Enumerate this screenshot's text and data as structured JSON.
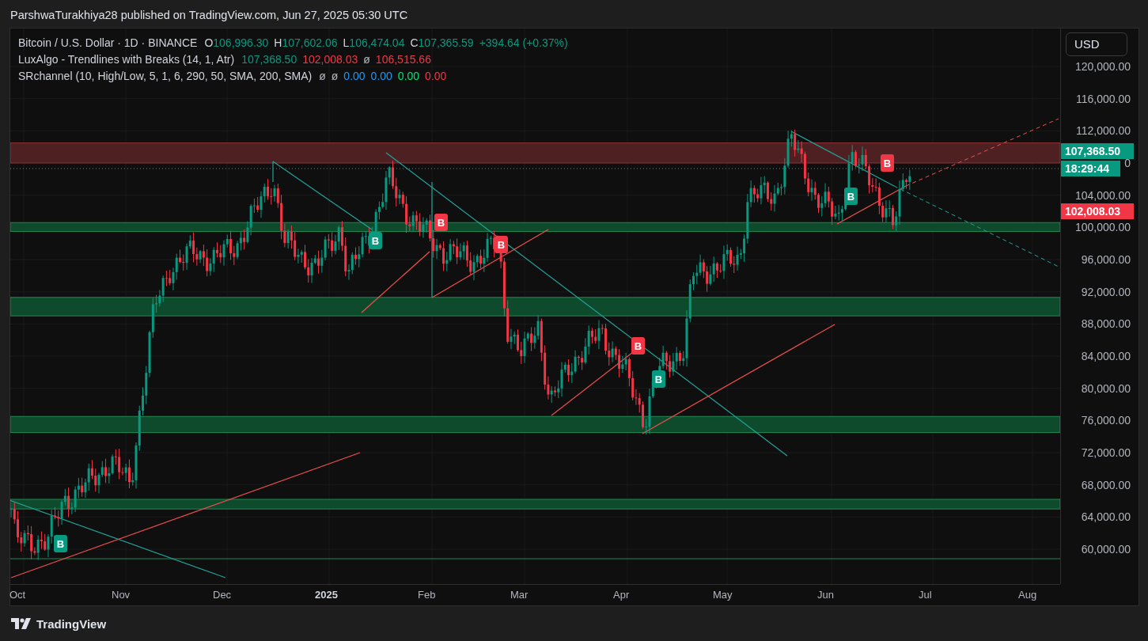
{
  "header": {
    "text": "ParshwaTurakhiya28 published on TradingView.com, Jun 27, 2025 05:30 UTC"
  },
  "legend": [
    {
      "label": "Bitcoin / U.S. Dollar · 1D · BINANCE",
      "values": [
        {
          "prefix": "O",
          "text": "106,996.30",
          "color": "#089981"
        },
        {
          "prefix": "H",
          "text": "107,602.06",
          "color": "#089981"
        },
        {
          "prefix": "L",
          "text": "106,474.04",
          "color": "#089981"
        },
        {
          "prefix": "C",
          "text": "107,365.59",
          "color": "#089981"
        },
        {
          "text": "+394.64 (+0.37%)",
          "color": "#089981"
        }
      ]
    },
    {
      "label": "LuxAlgo - Trendlines with Breaks (14, 1, Atr)",
      "values": [
        {
          "text": "107,368.50",
          "color": "#089981"
        },
        {
          "text": "102,008.03",
          "color": "#f23645"
        },
        {
          "text": "ø",
          "color": "#b2b5be"
        },
        {
          "text": "106,515.66",
          "color": "#f23645"
        }
      ]
    },
    {
      "label": "SRchannel (10, High/Low, 5, 1, 6, 290, 50, SMA, 200, SMA)",
      "values": [
        {
          "text": "ø",
          "color": "#b2b5be"
        },
        {
          "text": "ø",
          "color": "#b2b5be"
        },
        {
          "text": "0.00",
          "color": "#2196f3"
        },
        {
          "text": "0.00",
          "color": "#2196f3"
        },
        {
          "text": "0.00",
          "color": "#00e676"
        },
        {
          "text": "0.00",
          "color": "#f23645"
        }
      ]
    }
  ],
  "signals": [
    {
      "label": "B",
      "color": "#089981"
    },
    {
      "label": "B",
      "color": "#089981"
    },
    {
      "label": "B",
      "color": "#f23645"
    },
    {
      "label": "B",
      "color": "#f23645"
    },
    {
      "label": "B",
      "color": "#f23645"
    },
    {
      "label": "B",
      "color": "#089981"
    },
    {
      "label": "B",
      "color": "#089981"
    },
    {
      "label": "B",
      "color": "#f23645"
    }
  ],
  "price_axis": {
    "currency": "USD",
    "ticks": [
      "120,000.00",
      "116,000.00",
      "112,000.00",
      "104,000.00",
      "100,000.00",
      "96,000.00",
      "92,000.00",
      "88,000.00",
      "84,000.00",
      "80,000.00",
      "76,000.00",
      "72,000.00",
      "68,000.00",
      "64,000.00",
      "60,000.00"
    ],
    "tags": [
      {
        "text": "107,368.50",
        "color": "#089981"
      },
      {
        "text": "18:29:44",
        "color": "#089981"
      },
      {
        "text": "102,008.03",
        "color": "#f23645"
      }
    ],
    "partial_tick": "0"
  },
  "time_axis": [
    {
      "label": "Oct",
      "emphasized": false
    },
    {
      "label": "Nov",
      "emphasized": false
    },
    {
      "label": "Dec",
      "emphasized": false
    },
    {
      "label": "2025",
      "emphasized": true
    },
    {
      "label": "Feb",
      "emphasized": false
    },
    {
      "label": "Mar",
      "emphasized": false
    },
    {
      "label": "Apr",
      "emphasized": false
    },
    {
      "label": "May",
      "emphasized": false
    },
    {
      "label": "Jun",
      "emphasized": false
    },
    {
      "label": "Jul",
      "emphasized": false
    },
    {
      "label": "Aug",
      "emphasized": false
    }
  ],
  "footer": {
    "brand": "TradingView"
  }
}
